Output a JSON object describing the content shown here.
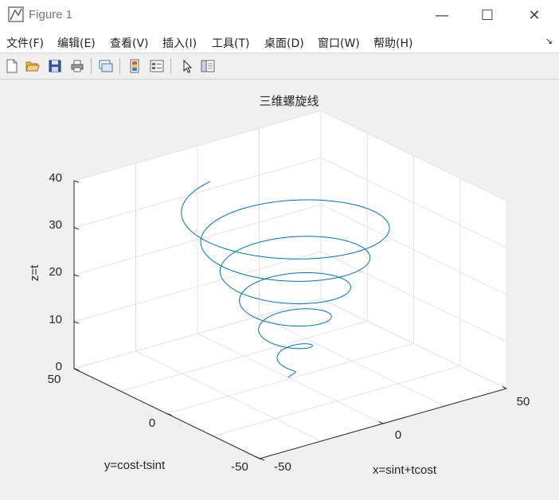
{
  "window": {
    "title": "Figure 1",
    "controls": {
      "minimize": "—",
      "maximize": "☐",
      "close": "✕"
    }
  },
  "menu": {
    "items": [
      {
        "label": "文件(F)"
      },
      {
        "label": "编辑(E)"
      },
      {
        "label": "查看(V)"
      },
      {
        "label": "插入(I)"
      },
      {
        "label": "工具(T)"
      },
      {
        "label": "桌面(D)"
      },
      {
        "label": "窗口(W)"
      },
      {
        "label": "帮助(H)"
      }
    ],
    "dock_arrow": "↘"
  },
  "toolbar": {
    "buttons": [
      "new-figure-icon",
      "open-file-icon",
      "save-icon",
      "print-icon",
      "link-plot-icon",
      "colorbar-icon",
      "legend-icon",
      "select-arrow-icon",
      "property-inspector-icon"
    ]
  },
  "chart_data": {
    "type": "line",
    "projection": "3d",
    "title": "三维螺旋线",
    "xlabel": "x=sint+tcost",
    "ylabel": "y=cost-tsint",
    "zlabel": "z=t",
    "xlim": [
      -50,
      50
    ],
    "ylim": [
      -50,
      50
    ],
    "zlim": [
      0,
      40
    ],
    "x_ticks": [
      "-50",
      "0",
      "50"
    ],
    "y_ticks": [
      "-50",
      "0",
      "50"
    ],
    "z_ticks": [
      "0",
      "10",
      "20",
      "30",
      "40"
    ],
    "grid": true,
    "series": [
      {
        "x_expr": "sin(t)+t*cos(t)",
        "y_expr": "cos(t)-t*sin(t)",
        "z_expr": "t",
        "t_range": [
          0,
          36
        ],
        "color": "#0072bd"
      }
    ]
  }
}
